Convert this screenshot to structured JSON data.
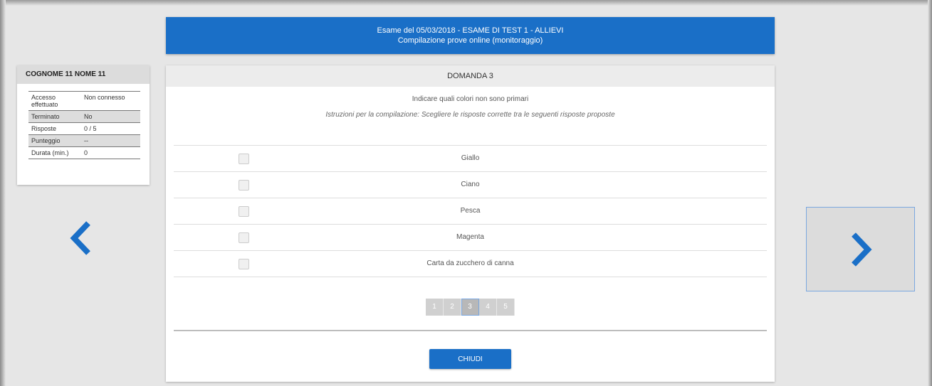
{
  "header": {
    "line1": "Esame del 05/03/2018 - ESAME DI TEST 1 - ALLIEVI",
    "line2": "Compilazione prove online (monitoraggio)"
  },
  "student": {
    "name": "COGNOME 11 NOME 11",
    "rows": [
      {
        "label": "Accesso effettuato",
        "value": "Non connesso"
      },
      {
        "label": "Terminato",
        "value": "No"
      },
      {
        "label": "Risposte",
        "value": "0 / 5"
      },
      {
        "label": "Punteggio",
        "value": "--"
      },
      {
        "label": "Durata (min.)",
        "value": "0"
      }
    ]
  },
  "question": {
    "title": "DOMANDA 3",
    "text": "Indicare quali colori non sono primari",
    "instructions": "Istruzioni per la compilazione: Scegliere le risposte corrette tra le seguenti risposte proposte",
    "answers": [
      "Giallo",
      "Ciano",
      "Pesca",
      "Magenta",
      "Carta da zucchero di canna"
    ]
  },
  "pager": {
    "pages": [
      "1",
      "2",
      "3",
      "4",
      "5"
    ],
    "current": "3"
  },
  "close_label": "CHIUDI",
  "icons": {
    "prev": "chevron-left-icon",
    "next": "chevron-right-icon"
  },
  "colors": {
    "accent": "#1a6fc7"
  }
}
